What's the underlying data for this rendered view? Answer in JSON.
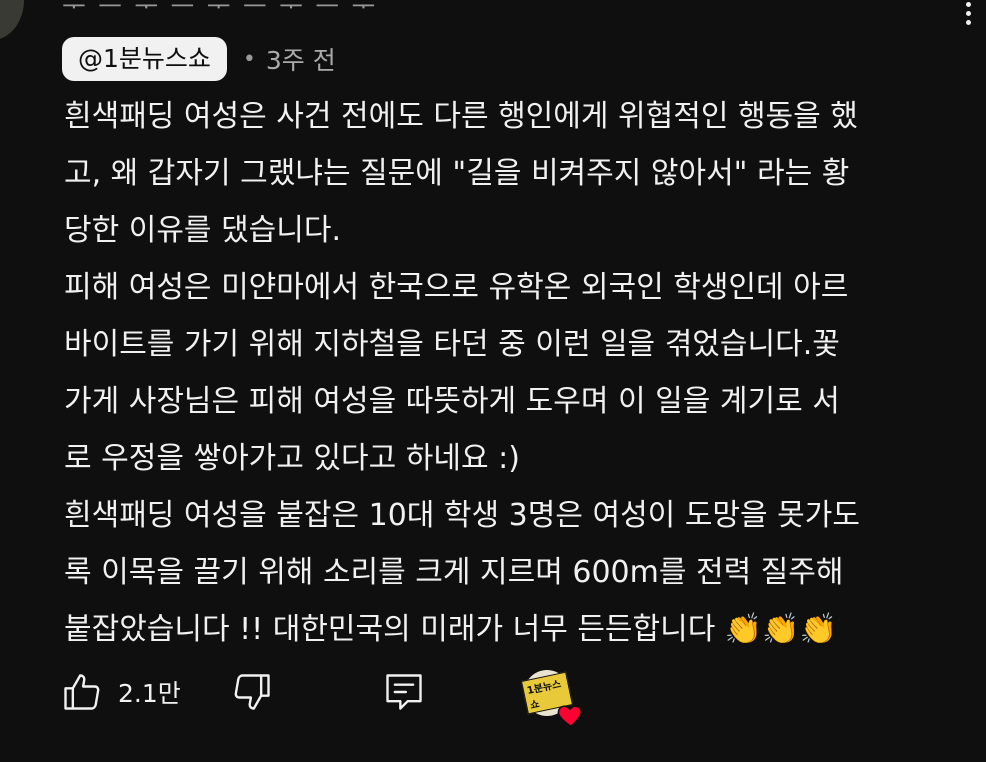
{
  "author": "@1분뉴스쇼",
  "separator": "•",
  "timestamp": "3주 전",
  "comment_lines": [
    "흰색패딩 여성은 사건 전에도 다른 행인에게 위협적인 행동을 했",
    "고, 왜 갑자기 그랬냐는 질문에 \"길을 비켜주지 않아서\" 라는 황",
    "당한 이유를 댔습니다.",
    "피해 여성은 미얀마에서 한국으로 유학온 외국인 학생인데 아르",
    "바이트를 가기 위해 지하철을 타던 중 이런 일을 겪었습니다.꽃",
    "가게 사장님은 피해 여성을 따뜻하게 도우며 이 일을 계기로 서",
    "로 우정을 쌓아가고 있다고 하네요 :)",
    "흰색패딩 여성을 붙잡은 10대 학생 3명은 여성이 도망을 못가도",
    "록 이목을 끌기 위해 소리를 크게 지르며 600m를 전력 질주해",
    "붙잡았습니다 !! 대한민국의 미래가 너무 든든합니다 "
  ],
  "emoji": "👏",
  "like_count": "2.1만",
  "avatar_logo_text": "1분뉴스쇼",
  "icons": {
    "like": "thumbs-up-icon",
    "dislike": "thumbs-down-icon",
    "reply": "reply-icon",
    "more": "more-vert-icon",
    "heart": "heart-icon"
  },
  "colors": {
    "background": "#0f0f0f",
    "text": "#f1f1f1",
    "secondary": "#aaaaaa",
    "heart": "#ff0033"
  }
}
